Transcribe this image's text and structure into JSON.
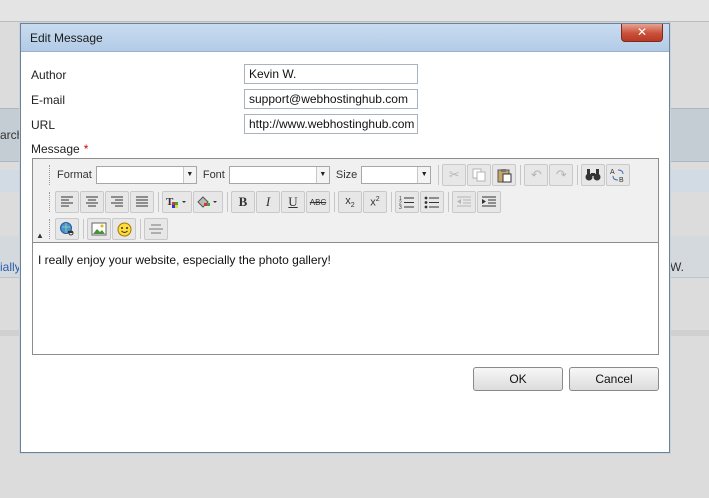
{
  "background": {
    "left_fragment_1": "arch",
    "left_fragment_2": "ially",
    "right_fragment": "W."
  },
  "dialog": {
    "title": "Edit Message",
    "close_glyph": "✕",
    "fields": {
      "author_label": "Author",
      "author_value": "Kevin W.",
      "email_label": "E-mail",
      "email_value": "support@webhostinghub.com",
      "url_label": "URL",
      "url_value": "http://www.webhostinghub.com",
      "message_label": "Message",
      "required_marker": "*"
    },
    "editor": {
      "format_label": "Format",
      "font_label": "Font",
      "size_label": "Size",
      "format_value": "",
      "font_value": "",
      "size_value": "",
      "toolbar_icons": {
        "row1": [
          "cut-icon",
          "copy-icon",
          "paste-icon",
          "undo-icon",
          "redo-icon",
          "find-icon",
          "replace-icon"
        ],
        "row2": [
          "align-left-icon",
          "align-center-icon",
          "align-right-icon",
          "align-justify-icon",
          "text-color-icon",
          "background-color-icon",
          "bold-icon",
          "italic-icon",
          "underline-icon",
          "strikethrough-icon",
          "subscript-icon",
          "superscript-icon",
          "numbered-list-icon",
          "bulleted-list-icon",
          "outdent-icon",
          "indent-icon"
        ],
        "row3": [
          "link-icon",
          "image-icon",
          "smiley-icon",
          "horizontal-rule-icon"
        ]
      },
      "content": "I really enjoy your website, especially the photo gallery!"
    },
    "buttons": {
      "ok": "OK",
      "cancel": "Cancel"
    }
  },
  "colors": {
    "titlebar": "#b8d0ea",
    "close_button": "#c9503a",
    "required": "#cc0000",
    "link_text": "#2a5dad"
  }
}
